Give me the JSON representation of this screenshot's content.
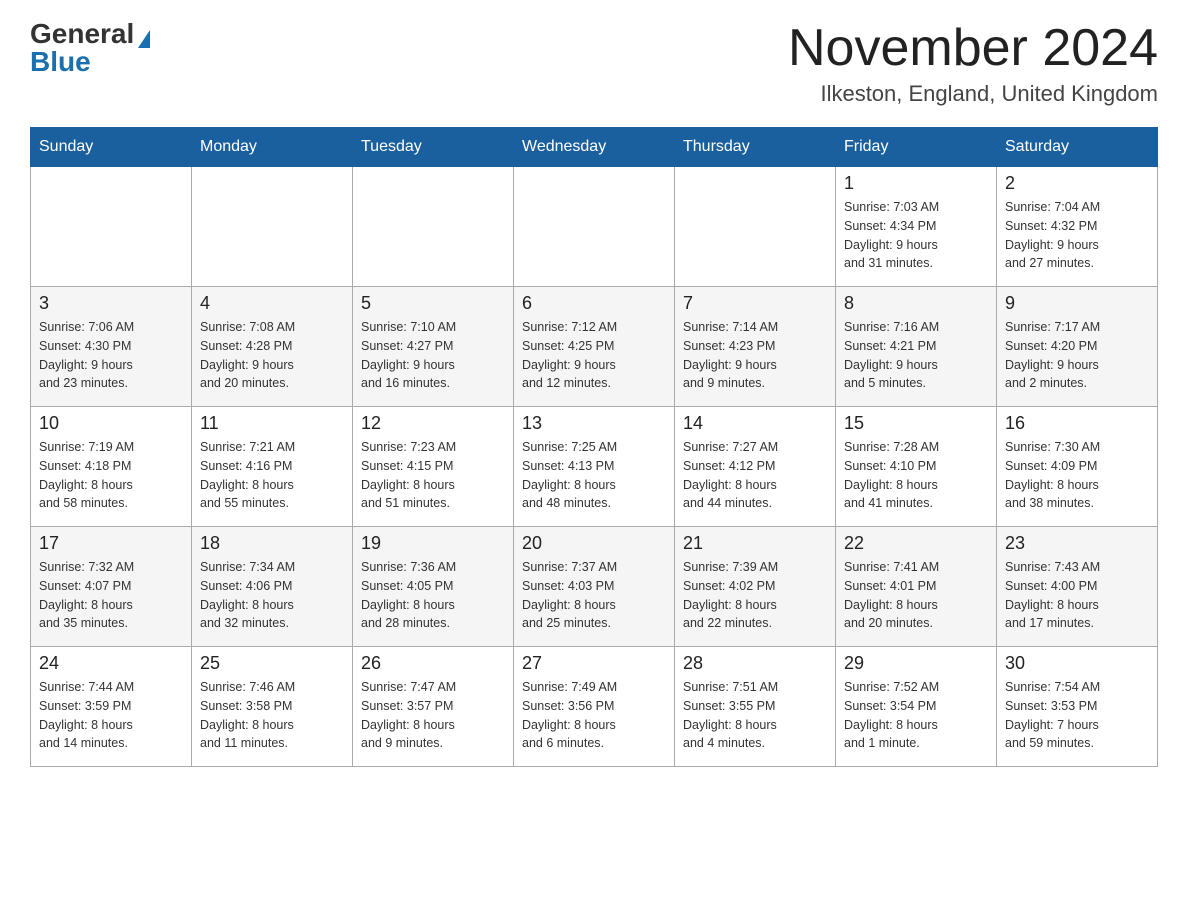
{
  "logo": {
    "general": "General",
    "blue": "Blue"
  },
  "header": {
    "month": "November 2024",
    "location": "Ilkeston, England, United Kingdom"
  },
  "days_of_week": [
    "Sunday",
    "Monday",
    "Tuesday",
    "Wednesday",
    "Thursday",
    "Friday",
    "Saturday"
  ],
  "weeks": [
    [
      {
        "day": "",
        "info": ""
      },
      {
        "day": "",
        "info": ""
      },
      {
        "day": "",
        "info": ""
      },
      {
        "day": "",
        "info": ""
      },
      {
        "day": "",
        "info": ""
      },
      {
        "day": "1",
        "info": "Sunrise: 7:03 AM\nSunset: 4:34 PM\nDaylight: 9 hours\nand 31 minutes."
      },
      {
        "day": "2",
        "info": "Sunrise: 7:04 AM\nSunset: 4:32 PM\nDaylight: 9 hours\nand 27 minutes."
      }
    ],
    [
      {
        "day": "3",
        "info": "Sunrise: 7:06 AM\nSunset: 4:30 PM\nDaylight: 9 hours\nand 23 minutes."
      },
      {
        "day": "4",
        "info": "Sunrise: 7:08 AM\nSunset: 4:28 PM\nDaylight: 9 hours\nand 20 minutes."
      },
      {
        "day": "5",
        "info": "Sunrise: 7:10 AM\nSunset: 4:27 PM\nDaylight: 9 hours\nand 16 minutes."
      },
      {
        "day": "6",
        "info": "Sunrise: 7:12 AM\nSunset: 4:25 PM\nDaylight: 9 hours\nand 12 minutes."
      },
      {
        "day": "7",
        "info": "Sunrise: 7:14 AM\nSunset: 4:23 PM\nDaylight: 9 hours\nand 9 minutes."
      },
      {
        "day": "8",
        "info": "Sunrise: 7:16 AM\nSunset: 4:21 PM\nDaylight: 9 hours\nand 5 minutes."
      },
      {
        "day": "9",
        "info": "Sunrise: 7:17 AM\nSunset: 4:20 PM\nDaylight: 9 hours\nand 2 minutes."
      }
    ],
    [
      {
        "day": "10",
        "info": "Sunrise: 7:19 AM\nSunset: 4:18 PM\nDaylight: 8 hours\nand 58 minutes."
      },
      {
        "day": "11",
        "info": "Sunrise: 7:21 AM\nSunset: 4:16 PM\nDaylight: 8 hours\nand 55 minutes."
      },
      {
        "day": "12",
        "info": "Sunrise: 7:23 AM\nSunset: 4:15 PM\nDaylight: 8 hours\nand 51 minutes."
      },
      {
        "day": "13",
        "info": "Sunrise: 7:25 AM\nSunset: 4:13 PM\nDaylight: 8 hours\nand 48 minutes."
      },
      {
        "day": "14",
        "info": "Sunrise: 7:27 AM\nSunset: 4:12 PM\nDaylight: 8 hours\nand 44 minutes."
      },
      {
        "day": "15",
        "info": "Sunrise: 7:28 AM\nSunset: 4:10 PM\nDaylight: 8 hours\nand 41 minutes."
      },
      {
        "day": "16",
        "info": "Sunrise: 7:30 AM\nSunset: 4:09 PM\nDaylight: 8 hours\nand 38 minutes."
      }
    ],
    [
      {
        "day": "17",
        "info": "Sunrise: 7:32 AM\nSunset: 4:07 PM\nDaylight: 8 hours\nand 35 minutes."
      },
      {
        "day": "18",
        "info": "Sunrise: 7:34 AM\nSunset: 4:06 PM\nDaylight: 8 hours\nand 32 minutes."
      },
      {
        "day": "19",
        "info": "Sunrise: 7:36 AM\nSunset: 4:05 PM\nDaylight: 8 hours\nand 28 minutes."
      },
      {
        "day": "20",
        "info": "Sunrise: 7:37 AM\nSunset: 4:03 PM\nDaylight: 8 hours\nand 25 minutes."
      },
      {
        "day": "21",
        "info": "Sunrise: 7:39 AM\nSunset: 4:02 PM\nDaylight: 8 hours\nand 22 minutes."
      },
      {
        "day": "22",
        "info": "Sunrise: 7:41 AM\nSunset: 4:01 PM\nDaylight: 8 hours\nand 20 minutes."
      },
      {
        "day": "23",
        "info": "Sunrise: 7:43 AM\nSunset: 4:00 PM\nDaylight: 8 hours\nand 17 minutes."
      }
    ],
    [
      {
        "day": "24",
        "info": "Sunrise: 7:44 AM\nSunset: 3:59 PM\nDaylight: 8 hours\nand 14 minutes."
      },
      {
        "day": "25",
        "info": "Sunrise: 7:46 AM\nSunset: 3:58 PM\nDaylight: 8 hours\nand 11 minutes."
      },
      {
        "day": "26",
        "info": "Sunrise: 7:47 AM\nSunset: 3:57 PM\nDaylight: 8 hours\nand 9 minutes."
      },
      {
        "day": "27",
        "info": "Sunrise: 7:49 AM\nSunset: 3:56 PM\nDaylight: 8 hours\nand 6 minutes."
      },
      {
        "day": "28",
        "info": "Sunrise: 7:51 AM\nSunset: 3:55 PM\nDaylight: 8 hours\nand 4 minutes."
      },
      {
        "day": "29",
        "info": "Sunrise: 7:52 AM\nSunset: 3:54 PM\nDaylight: 8 hours\nand 1 minute."
      },
      {
        "day": "30",
        "info": "Sunrise: 7:54 AM\nSunset: 3:53 PM\nDaylight: 7 hours\nand 59 minutes."
      }
    ]
  ]
}
